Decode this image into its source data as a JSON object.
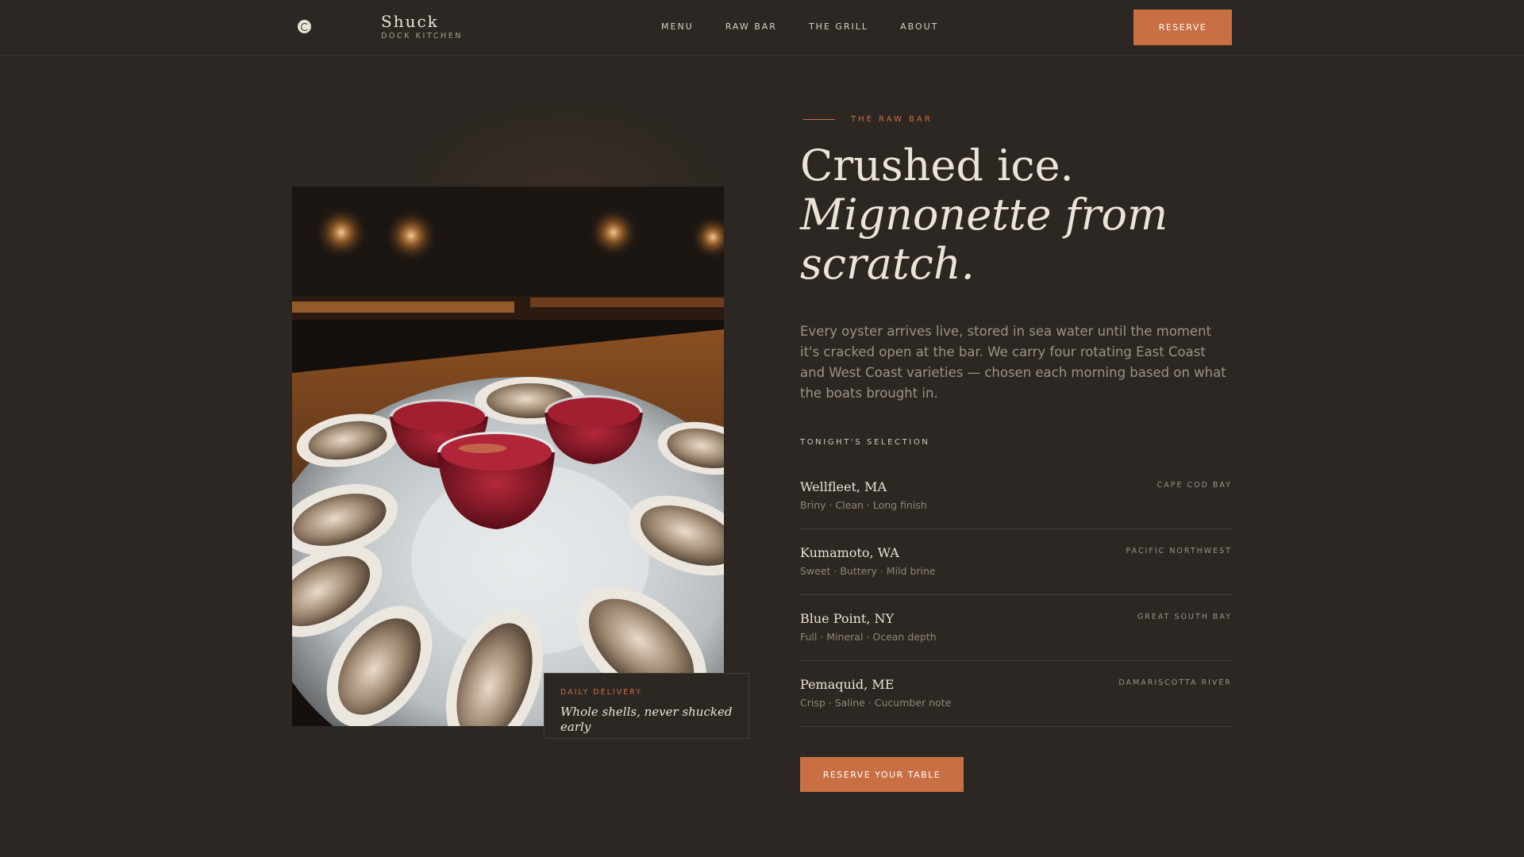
{
  "brand": {
    "name": "Shuck",
    "subtitle": "DOCK KITCHEN",
    "logo_icon": "oyster-shell-icon"
  },
  "nav": {
    "items": [
      {
        "label": "MENU"
      },
      {
        "label": "RAW BAR"
      },
      {
        "label": "THE GRILL"
      },
      {
        "label": "ABOUT"
      }
    ],
    "reserve_label": "RESERVE"
  },
  "hero": {
    "image_alt": "Oysters on crushed ice with mignonette cups",
    "caption_eyebrow": "DAILY DELIVERY",
    "caption_text": "Whole shells, never shucked early"
  },
  "section": {
    "eyebrow": "THE RAW BAR",
    "headline_line1": "Crushed ice.",
    "headline_line2": "Mignonette from",
    "headline_line3": "scratch.",
    "body": "Every oyster arrives live, stored in sea water until the moment it's cracked open at the bar. We carry four rotating East Coast and West Coast varieties — chosen each morning based on what the boats brought in.",
    "selection_heading": "TONIGHT'S SELECTION",
    "oysters": [
      {
        "name": "Wellfleet, MA",
        "notes": "Briny · Clean · Long finish",
        "region": "CAPE COD BAY"
      },
      {
        "name": "Kumamoto, WA",
        "notes": "Sweet · Buttery · Mild brine",
        "region": "PACIFIC NORTHWEST"
      },
      {
        "name": "Blue Point, NY",
        "notes": "Full · Mineral · Ocean depth",
        "region": "GREAT SOUTH BAY"
      },
      {
        "name": "Pemaquid, ME",
        "notes": "Crisp · Saline · Cucumber note",
        "region": "DAMARISCOTTA RIVER"
      }
    ],
    "cta_label": "RESERVE YOUR TABLE"
  },
  "colors": {
    "background": "#2c2722",
    "accent": "#c86f43",
    "text": "#ece4d8",
    "muted": "#9c9386"
  }
}
